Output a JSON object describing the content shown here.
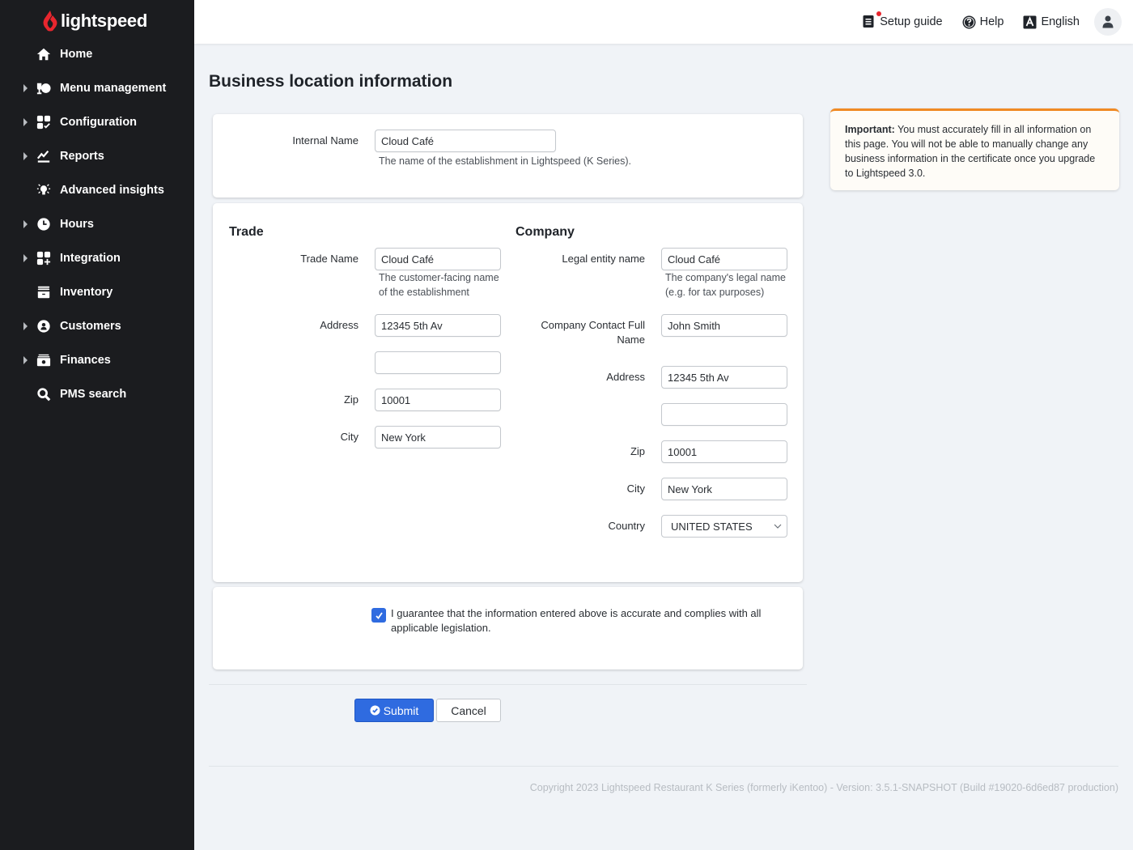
{
  "brand": {
    "name": "lightspeed",
    "accent": "#e8262e"
  },
  "sidebar": {
    "items": [
      {
        "label": "Home",
        "icon": "home-icon",
        "expandable": false
      },
      {
        "label": "Menu management",
        "icon": "menu-management-icon",
        "expandable": true
      },
      {
        "label": "Configuration",
        "icon": "configuration-icon",
        "expandable": true
      },
      {
        "label": "Reports",
        "icon": "reports-icon",
        "expandable": true
      },
      {
        "label": "Advanced insights",
        "icon": "lightbulb-icon",
        "expandable": false
      },
      {
        "label": "Hours",
        "icon": "clock-icon",
        "expandable": true
      },
      {
        "label": "Integration",
        "icon": "integration-icon",
        "expandable": true
      },
      {
        "label": "Inventory",
        "icon": "inventory-icon",
        "expandable": false
      },
      {
        "label": "Customers",
        "icon": "customer-icon",
        "expandable": true
      },
      {
        "label": "Finances",
        "icon": "finances-icon",
        "expandable": true
      },
      {
        "label": "PMS search",
        "icon": "search-icon",
        "expandable": false
      }
    ]
  },
  "topbar": {
    "setup_guide": "Setup guide",
    "help": "Help",
    "language": "English"
  },
  "page": {
    "title": "Business location information"
  },
  "internal": {
    "label": "Internal Name",
    "value": "Cloud Café",
    "help": "The name of the establishment in Lightspeed (K Series)."
  },
  "trade": {
    "title": "Trade",
    "trade_name_label": "Trade Name",
    "trade_name_value": "Cloud Café",
    "trade_name_help": "The customer-facing name of the establishment",
    "address_label": "Address",
    "address1_value": "12345 5th Av",
    "address2_value": "",
    "zip_label": "Zip",
    "zip_value": "10001",
    "city_label": "City",
    "city_value": "New York"
  },
  "company": {
    "title": "Company",
    "legal_label": "Legal entity name",
    "legal_value": "Cloud Café",
    "legal_help": "The company's legal name (e.g. for tax purposes)",
    "contact_label": "Company Contact Full Name",
    "contact_value": "John Smith",
    "address_label": "Address",
    "address1_value": "12345 5th Av",
    "address2_value": "",
    "zip_label": "Zip",
    "zip_value": "10001",
    "city_label": "City",
    "city_value": "New York",
    "country_label": "Country",
    "country_value": "UNITED STATES"
  },
  "guarantee": {
    "checked": true,
    "text": "I guarantee that the information entered above is accurate and complies with all applicable legislation."
  },
  "actions": {
    "submit": "Submit",
    "cancel": "Cancel"
  },
  "notice": {
    "strong": "Important:",
    "text": " You must accurately fill in all information on this page. You will not be able to manually change any business information in the certificate once you upgrade to Lightspeed 3.0."
  },
  "footer": {
    "text": "Copyright 2023 Lightspeed Restaurant K Series (formerly iKentoo) - Version: 3.5.1-SNAPSHOT (Build #19020-6d6ed87 production)"
  }
}
